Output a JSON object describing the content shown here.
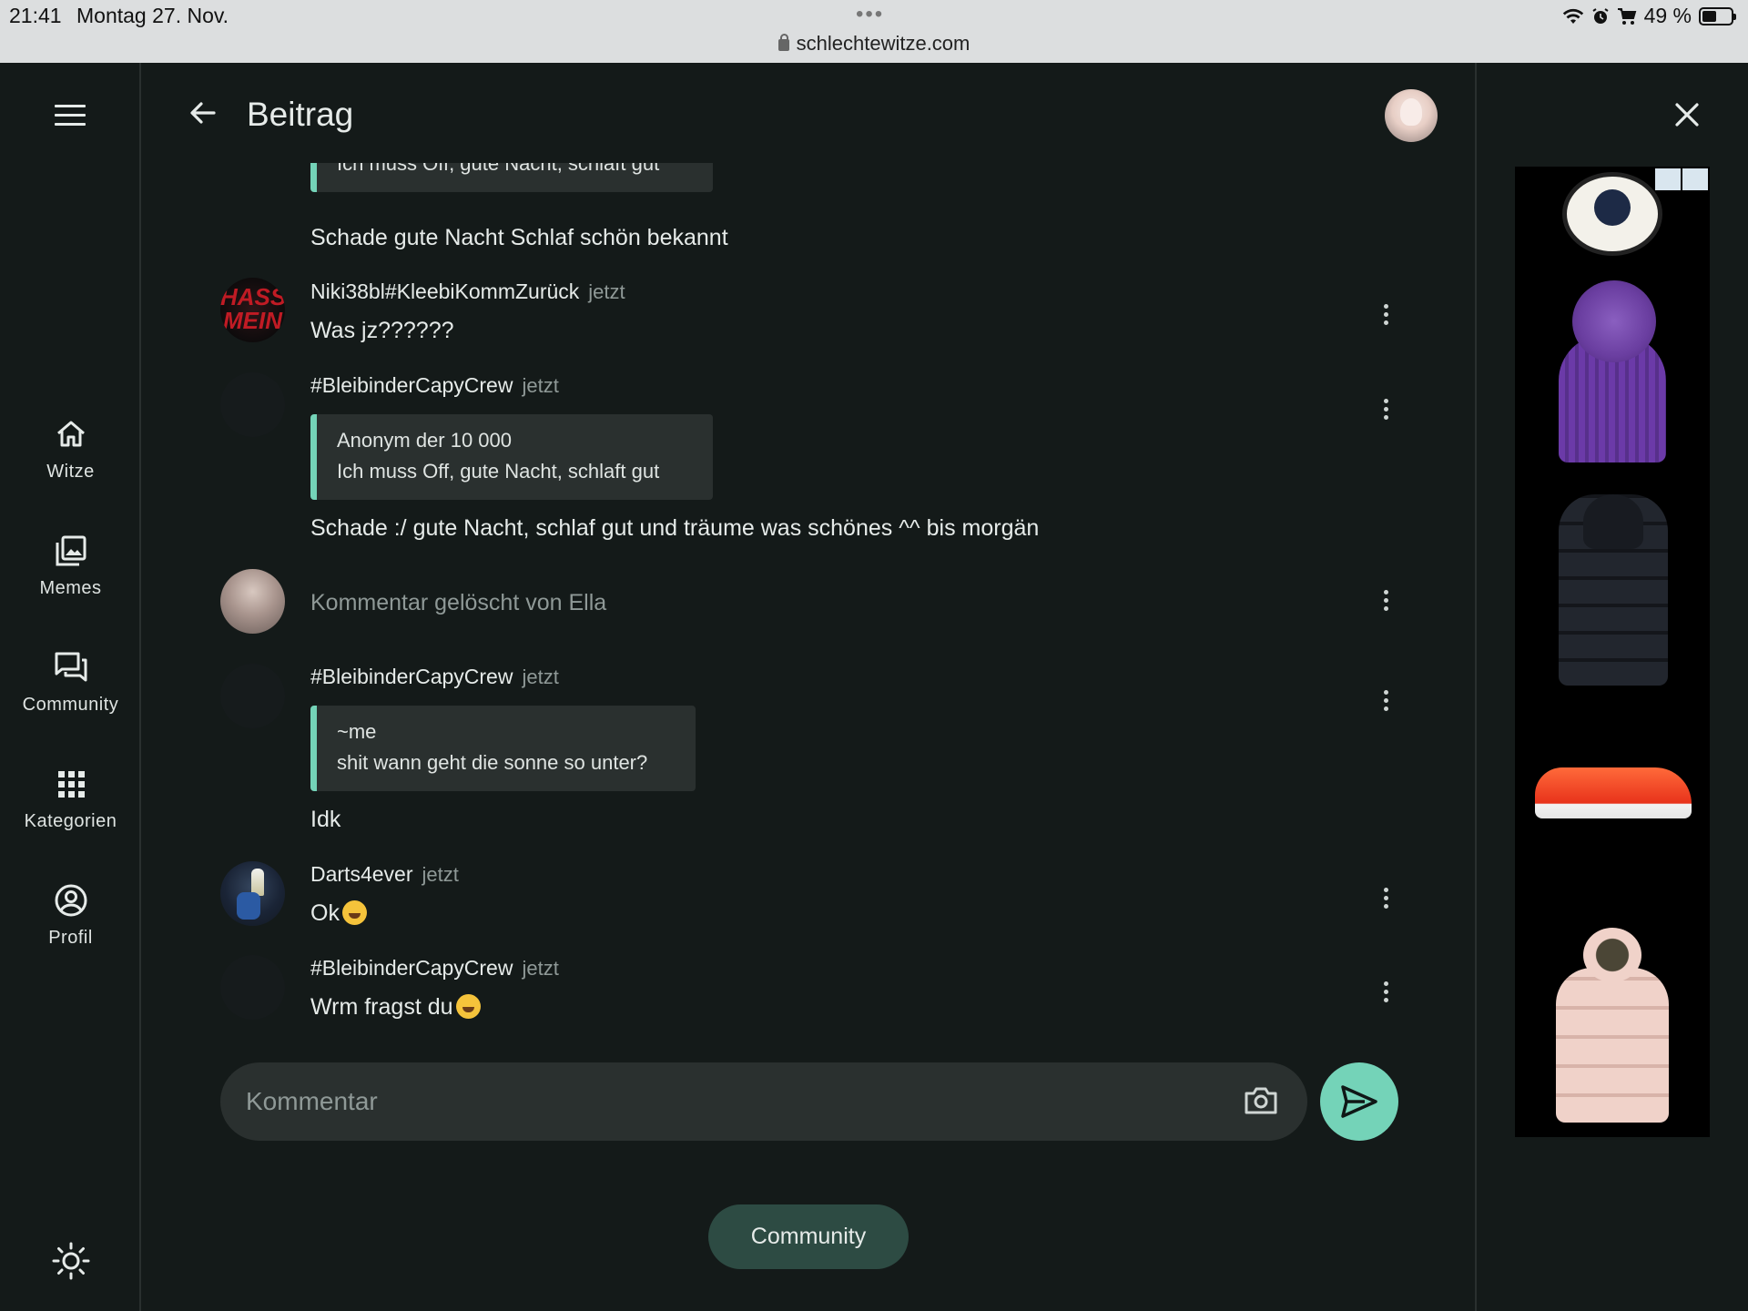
{
  "status_bar": {
    "time": "21:41",
    "date": "Montag 27. Nov.",
    "dots": "•••",
    "url": "schlechtewitze.com",
    "battery": "49 %",
    "battery_level": 0.49
  },
  "sidebar": {
    "items": [
      {
        "label": "Witze",
        "icon": "home-icon"
      },
      {
        "label": "Memes",
        "icon": "images-icon"
      },
      {
        "label": "Community",
        "icon": "forum-icon"
      },
      {
        "label": "Kategorien",
        "icon": "grid-icon"
      },
      {
        "label": "Profil",
        "icon": "account-circle-icon"
      }
    ],
    "theme_icon": "sun-icon"
  },
  "header": {
    "title": "Beitrag"
  },
  "comments": [
    {
      "quote_text": "Ich muss Off, gute Nacht, schlaft gut",
      "text": "Schade gute Nacht Schlaf schön bekannt"
    },
    {
      "author": "Niki38bl#KleebiKommZurück",
      "time": "jetzt",
      "text": "Was jz??????",
      "avatar_text": "HASS MEIN"
    },
    {
      "author": "#BleibinderCapyCrew",
      "time": "jetzt",
      "quote_author": "Anonym der 10 000",
      "quote_text": "Ich muss Off, gute Nacht, schlaft gut",
      "text": "Schade :/ gute Nacht, schlaf gut und träume was schönes ^^ bis morgän"
    },
    {
      "text": "Kommentar gelöscht von Ella"
    },
    {
      "author": "#BleibinderCapyCrew",
      "time": "jetzt",
      "quote_author": "~me",
      "quote_text": "shit wann geht die sonne so unter?",
      "text": "Idk"
    },
    {
      "author": "Darts4ever",
      "time": "jetzt",
      "text": "Ok"
    },
    {
      "author": "#BleibinderCapyCrew",
      "time": "jetzt",
      "text": "Wrm fragst du"
    }
  ],
  "composer": {
    "placeholder": "Kommentar",
    "camera_icon": "camera-icon",
    "send_icon": "send-icon"
  },
  "footer": {
    "community_button": "Community"
  },
  "colors": {
    "background": "#141a19",
    "accent": "#74d3b8",
    "quote_bg": "#2a302f",
    "pill_bg": "#2d4b43"
  }
}
